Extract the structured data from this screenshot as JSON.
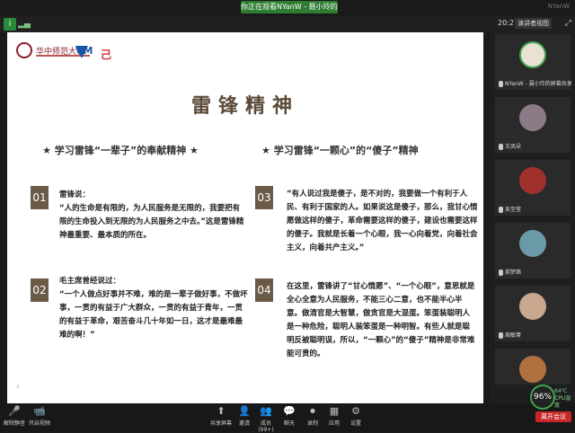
{
  "topbar": {
    "share_label": "你正在观看NYanW - 聂小玲的屏幕",
    "right_label": "NYanW"
  },
  "subbar": {
    "clock": "20:27",
    "view_label": "演讲者视图"
  },
  "slide": {
    "logo_text": "华中师范大学",
    "logo2_text": "VM",
    "logo3_text": "己",
    "title": "雷锋精神",
    "left_heading": "★ 学习雷锋“一辈子”的奉献精神 ★",
    "right_heading": "★ 学习雷锋“一颗心”的“傻子”精神",
    "items": [
      {
        "num": "01",
        "text": "雷锋说：\n“人的生命是有限的，为人民服务是无限的，我要把有限的生命投入到无限的为人民服务之中去。”这是雷锋精神最重要、最本质的所在。"
      },
      {
        "num": "02",
        "text": "毛主席曾经说过：\n“一个人做点好事并不难，难的是一辈子做好事，不做坏事，一贯的有益于广大群众，一贯的有益于青年，一贯的有益于革命，艰苦奋斗几十年如一日，这才是最难最难的啊！”"
      },
      {
        "num": "03",
        "text": "“有人说过我是傻子，是不对的，我要做一个有利于人民、有利于国家的人。如果说这是傻子，那么，我甘心情愿做这样的傻子，革命需要这样的傻子，建设也需要这样的傻子。我就是长着一个心眼，我一心向着党，向着社会主义，向着共产主义。”"
      },
      {
        "num": "04",
        "text": "在这里，雷锋讲了“甘心情愿”、“一个心眼”，意思就是全心全意为人民服务，不能三心二意，也不能半心半意。做清官是大智慧，做贪官是大混蛋。笨蛋装聪明人是一种危险，聪明人装笨蛋是一种明智。有些人就是聪明反被聪明误，所以，“一颗心”的“傻子”精神是非常难能可贵的。"
      }
    ]
  },
  "participants": [
    {
      "name": "NYanW - 聂小玲的屏幕共享",
      "color": "#e9e1d4"
    },
    {
      "name": "王凤朵",
      "color": "#8c7a86"
    },
    {
      "name": "吴至莹",
      "color": "#a0302c"
    },
    {
      "name": "郝梦茜",
      "color": "#6a9aa8"
    },
    {
      "name": "周敏菁",
      "color": "#caa890"
    },
    {
      "name": "",
      "color": "#b07040"
    }
  ],
  "bottombar": {
    "buttons": [
      {
        "label": "解除静音",
        "icon": "🎤"
      },
      {
        "label": "开启视频",
        "icon": "📹"
      },
      {
        "label": "共享屏幕",
        "icon": "⬆"
      },
      {
        "label": "邀请",
        "icon": "👤"
      },
      {
        "label": "成员(99+)",
        "icon": "👥"
      },
      {
        "label": "聊天",
        "icon": "💬"
      },
      {
        "label": "录制",
        "icon": "⏺"
      },
      {
        "label": "应用",
        "icon": "▦"
      },
      {
        "label": "设置",
        "icon": "⚙"
      }
    ],
    "end_label": "离开会议",
    "cpu_value": "96%",
    "cpu_temp": "64℃",
    "cpu_label": "CPU温度"
  }
}
